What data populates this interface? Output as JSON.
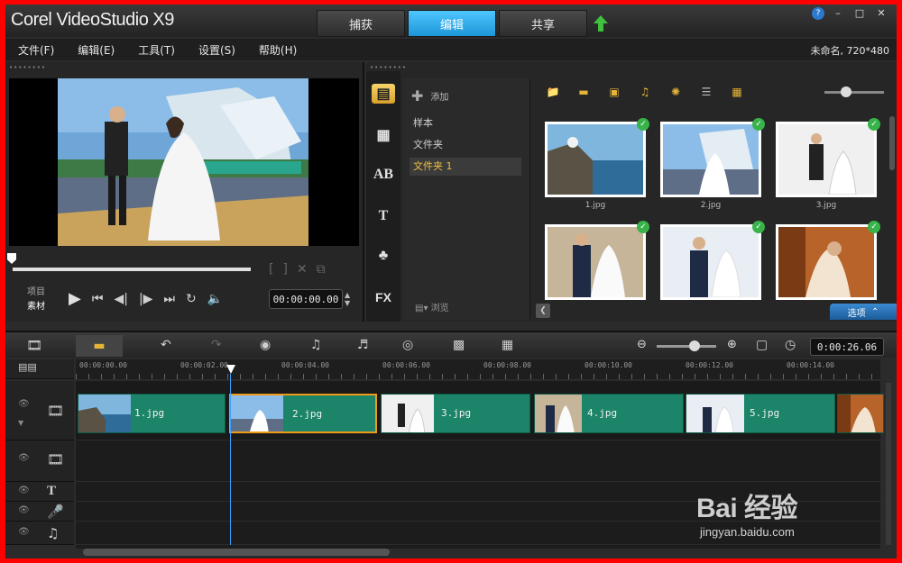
{
  "app": {
    "title": "Corel VideoStudio X9",
    "tabs": [
      "捕获",
      "编辑",
      "共享"
    ],
    "active_tab": "编辑",
    "project_info": "未命名, 720*480"
  },
  "menu": [
    "文件(F)",
    "编辑(E)",
    "工具(T)",
    "设置(S)",
    "帮助(H)"
  ],
  "player": {
    "project_label": "项目",
    "clip_label": "素材",
    "timecode": "00:00:00.00"
  },
  "library": {
    "add_label": "添加",
    "folders": [
      "样本",
      "文件夹",
      "文件夹 1"
    ],
    "active_folder": "文件夹 1",
    "browse_label": "浏览",
    "options_label": "选项",
    "thumbnails": [
      {
        "label": "1.jpg",
        "checked": true
      },
      {
        "label": "2.jpg",
        "checked": true
      },
      {
        "label": "3.jpg",
        "checked": true
      },
      {
        "label": "",
        "checked": true
      },
      {
        "label": "",
        "checked": true
      },
      {
        "label": "",
        "checked": true
      }
    ],
    "side_icons": [
      "media-icon",
      "instant-project-icon",
      "transition-icon",
      "title-icon",
      "graphic-icon",
      "filter-icon"
    ]
  },
  "timeline": {
    "time": "0:00:26.06",
    "ruler": [
      "00:00:00.00",
      "00:00:02.00",
      "00:00:04.00",
      "00:00:06.00",
      "00:00:08.00",
      "00:00:10.00",
      "00:00:12.00",
      "00:00:14.00"
    ],
    "clips": [
      "1.jpg",
      "2.jpg",
      "3.jpg",
      "4.jpg",
      "5.jpg",
      ""
    ]
  },
  "watermark": {
    "brand": "Bai 经验",
    "url": "jingyan.baidu.com"
  },
  "colors": {
    "active_tab": "#1c96d8",
    "clip": "#1c8468",
    "frame_border": "#ff0000",
    "check": "#38b34a"
  }
}
